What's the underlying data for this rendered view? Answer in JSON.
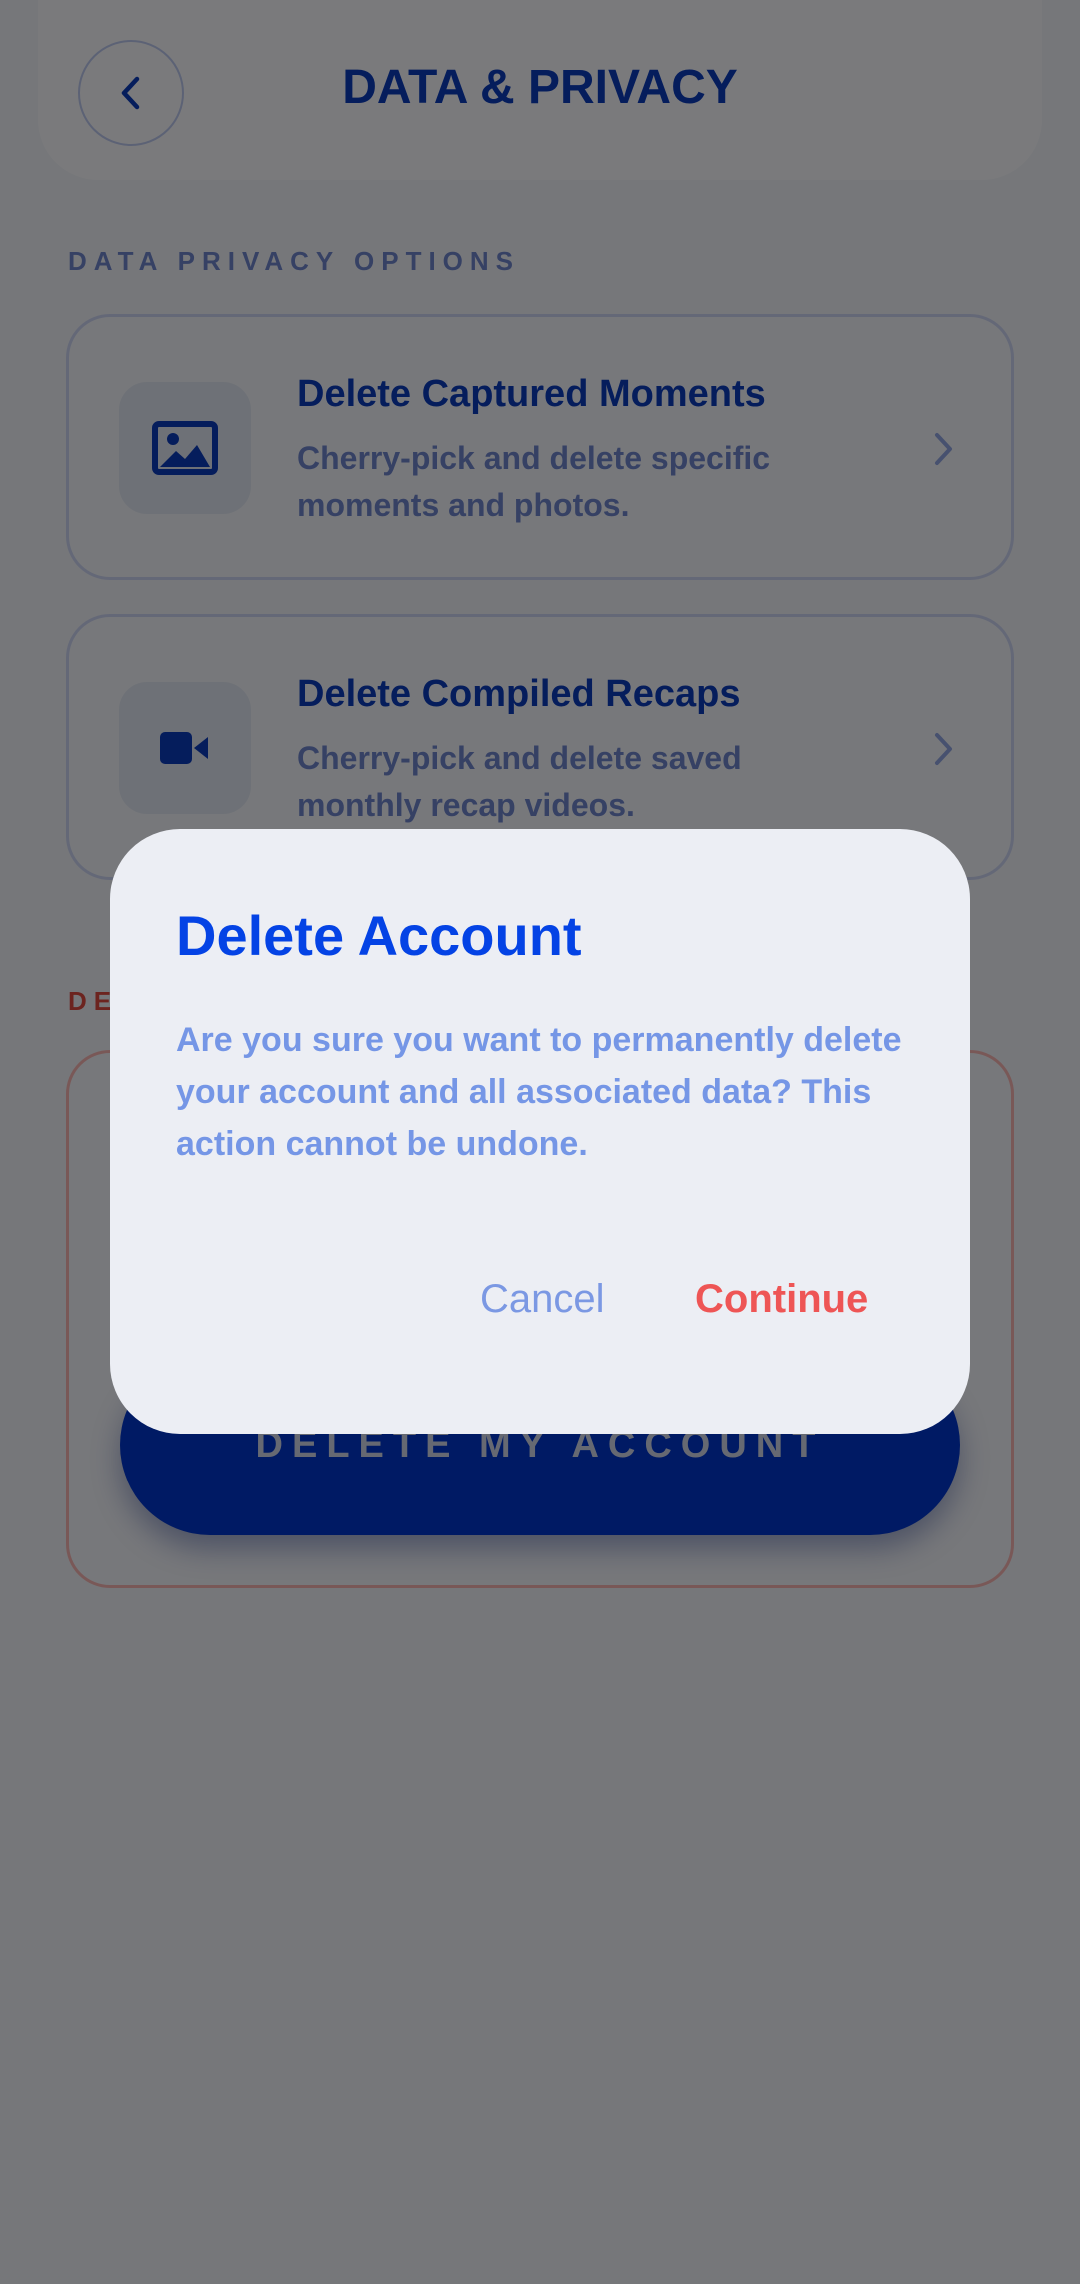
{
  "header": {
    "title": "DATA & PRIVACY"
  },
  "privacy_section": {
    "label": "DATA PRIVACY OPTIONS",
    "items": [
      {
        "title": "Delete Captured Moments",
        "description": "Cherry-pick and delete specific moments and photos.",
        "icon": "image-icon"
      },
      {
        "title": "Delete Compiled Recaps",
        "description": "Cherry-pick and delete saved monthly recap videos.",
        "icon": "video-icon"
      }
    ]
  },
  "danger_section": {
    "label": "DE",
    "button_label": "DELETE MY ACCOUNT"
  },
  "dialog": {
    "title": "Delete Account",
    "message": "Are you sure you want to permanently delete your account and all associated data? This action cannot be undone.",
    "cancel_label": "Cancel",
    "continue_label": "Continue"
  },
  "colors": {
    "primary": "#0034C8",
    "title_blue": "#0B3AB8",
    "muted_blue": "#6C82C8",
    "danger": "#EE5555",
    "surface": "#ECEEF4"
  }
}
